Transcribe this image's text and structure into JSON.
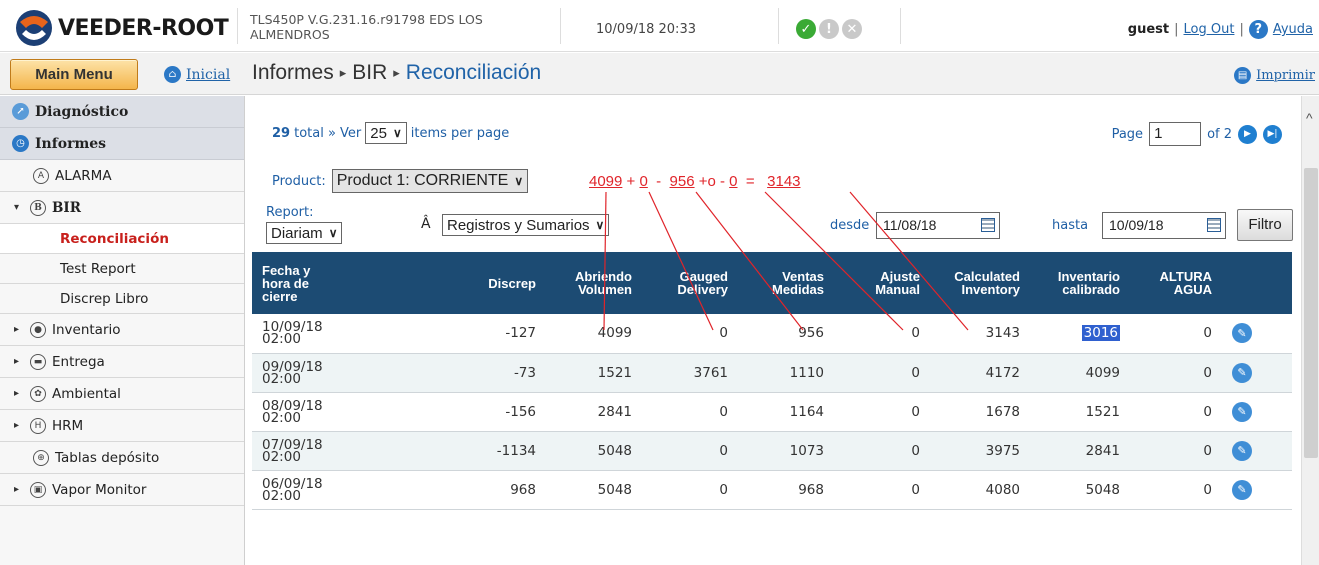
{
  "header": {
    "brand": "VEEDER-ROOT",
    "system_info": "TLS450P V.G.231.16.r91798 EDS LOS ALMENDROS",
    "datetime": "10/09/18 20:33",
    "status_icons": [
      "check-icon",
      "alarm-icon",
      "close-icon"
    ],
    "user": "guest",
    "logout": "Log Out",
    "help": "Ayuda",
    "help_glyph": "?"
  },
  "nav": {
    "main_menu": "Main Menu",
    "home": "Inicial",
    "breadcrumb": [
      "Informes",
      "BIR",
      "Reconciliación"
    ],
    "print": "Imprimir"
  },
  "sidebar": {
    "sections": [
      {
        "label": "Diagnóstico",
        "icon": "chart-icon"
      },
      {
        "label": "Informes",
        "icon": "clock-icon"
      }
    ],
    "items": [
      {
        "label": "ALARMA",
        "icon": "alarm-icon"
      },
      {
        "label": "BIR",
        "icon": "bir-icon",
        "expanded": true
      },
      {
        "label": "Reconciliación",
        "active": true
      },
      {
        "label": "Test Report"
      },
      {
        "label": "Discrep Libro"
      },
      {
        "label": "Inventario",
        "icon": "inventory-icon"
      },
      {
        "label": "Entrega",
        "icon": "truck-icon"
      },
      {
        "label": "Ambiental",
        "icon": "environment-icon"
      },
      {
        "label": "HRM",
        "icon": "hrm-icon"
      },
      {
        "label": "Tablas depósito",
        "icon": "table-icon"
      },
      {
        "label": "Vapor Monitor",
        "icon": "vapor-icon"
      }
    ]
  },
  "pager": {
    "total": "29",
    "total_suffix": "total » Ver",
    "per_page": "25",
    "items_label": "items per page",
    "page_label": "Page",
    "page": "1",
    "of_label": "of 2"
  },
  "filters": {
    "product_label": "Product:",
    "product_value": "Product 1: CORRIENTE",
    "report_label": "Report:",
    "report_value": "Diariam",
    "hat_glyph": "Â",
    "summary_value": "Registros y Sumarios",
    "desde_label": "desde",
    "desde_value": "11/08/18",
    "hasta_label": "hasta",
    "hasta_value": "10/09/18",
    "filter_button": "Filtro"
  },
  "table": {
    "headers": [
      [
        "Fecha y",
        "hora de",
        "cierre"
      ],
      [
        "Discrep"
      ],
      [
        "Abriendo",
        "Volumen"
      ],
      [
        "Gauged",
        "Delivery"
      ],
      [
        "Ventas",
        "Medidas"
      ],
      [
        "Ajuste",
        "Manual"
      ],
      [
        "Calculated",
        "Inventory"
      ],
      [
        "Inventario",
        "calibrado"
      ],
      [
        "ALTURA",
        "AGUA"
      ]
    ],
    "rows": [
      {
        "date": "10/09/18",
        "time": "02:00",
        "discrep": "-127",
        "abriendo": "4099",
        "gauged": "0",
        "ventas": "956",
        "ajuste": "0",
        "calculated": "3143",
        "calibrado": "3016",
        "agua": "0"
      },
      {
        "date": "09/09/18",
        "time": "02:00",
        "discrep": "-73",
        "abriendo": "1521",
        "gauged": "3761",
        "ventas": "1110",
        "ajuste": "0",
        "calculated": "4172",
        "calibrado": "4099",
        "agua": "0"
      },
      {
        "date": "08/09/18",
        "time": "02:00",
        "discrep": "-156",
        "abriendo": "2841",
        "gauged": "0",
        "ventas": "1164",
        "ajuste": "0",
        "calculated": "1678",
        "calibrado": "1521",
        "agua": "0"
      },
      {
        "date": "07/09/18",
        "time": "02:00",
        "discrep": "-1134",
        "abriendo": "5048",
        "gauged": "0",
        "ventas": "1073",
        "ajuste": "0",
        "calculated": "3975",
        "calibrado": "2841",
        "agua": "0"
      },
      {
        "date": "06/09/18",
        "time": "02:00",
        "discrep": "968",
        "abriendo": "5048",
        "gauged": "0",
        "ventas": "968",
        "ajuste": "0",
        "calculated": "4080",
        "calibrado": "5048",
        "agua": "0"
      }
    ]
  },
  "annotation": {
    "terms": [
      "4099",
      "0",
      "956",
      "o",
      "0",
      "3143"
    ],
    "ops": [
      "+",
      "-",
      "+",
      "-",
      "="
    ],
    "color": "#e0242a"
  },
  "colors": {
    "header_blue": "#1c4b73",
    "link_blue": "#2063a8",
    "active_red": "#c8201c",
    "ok_green": "#3aaa35",
    "annotation_red": "#e0242a"
  }
}
